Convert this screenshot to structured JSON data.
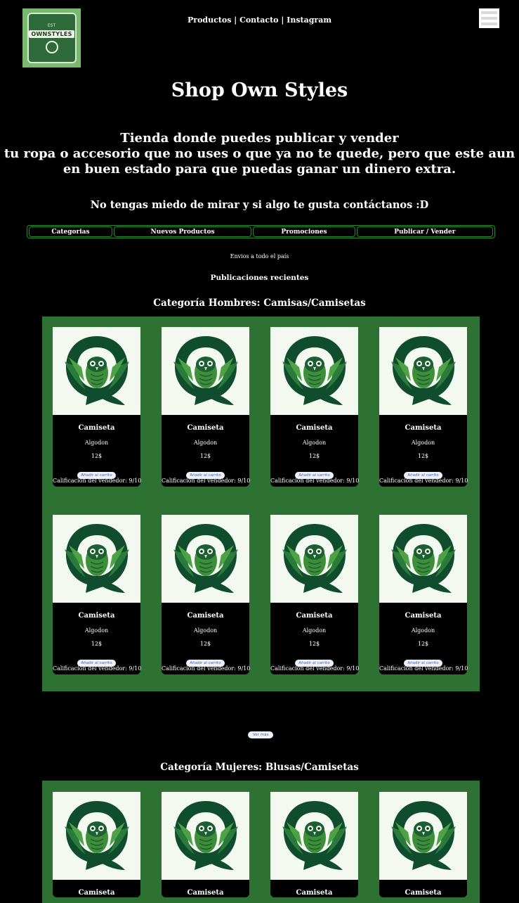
{
  "brand": {
    "logo_top": "EST",
    "logo_text": "OWNSTYLES"
  },
  "nav": {
    "items": [
      "Productos",
      "Contacto",
      "Instagram"
    ],
    "separator": " | "
  },
  "title": "Shop Own Styles",
  "tagline": {
    "line1": "Tienda donde puedes publicar y vender",
    "line2": "tu ropa o accesorio que no uses o que ya no te quede, pero que este aun en buen estado para que puedas ganar un dinero extra."
  },
  "subtagline": "No tengas miedo de mirar y si algo te gusta contáctanos :D",
  "menu": [
    "Categorias",
    "Nuevos Productos",
    "Promociones",
    "Publicar / Vender"
  ],
  "shipping": "Envios a todo el país",
  "recent_label": "Publicaciones recientes",
  "categories": [
    {
      "title": "Categoría Hombres: Camisas/Camisetas",
      "products": [
        {
          "name": "Camiseta",
          "material": "Algodon",
          "price": "12$",
          "button": "Añadir al carrito",
          "rating": "Calificación del vendedor: 9/10"
        },
        {
          "name": "Camiseta",
          "material": "Algodon",
          "price": "12$",
          "button": "Añadir al carrito",
          "rating": "Calificación del vendedor: 9/10"
        },
        {
          "name": "Camiseta",
          "material": "Algodon",
          "price": "12$",
          "button": "Añadir al carrito",
          "rating": "Calificación del vendedor: 9/10"
        },
        {
          "name": "Camiseta",
          "material": "Algodon",
          "price": "12$",
          "button": "Añadir al carrito",
          "rating": "Calificación del vendedor: 9/10"
        },
        {
          "name": "Camiseta",
          "material": "Algodon",
          "price": "12$",
          "button": "Añadir al carrito",
          "rating": "Calificación del vendedor: 9/10"
        },
        {
          "name": "Camiseta",
          "material": "Algodon",
          "price": "12$",
          "button": "Añadir al carrito",
          "rating": "Calificación del vendedor: 9/10"
        },
        {
          "name": "Camiseta",
          "material": "Algodon",
          "price": "12$",
          "button": "Añadir al carrito",
          "rating": "Calificación del vendedor: 9/10"
        },
        {
          "name": "Camiseta",
          "material": "Algodon",
          "price": "12$",
          "button": "Añadir al carrito",
          "rating": "Calificación del vendedor: 9/10"
        }
      ],
      "more_button": "Ver más"
    },
    {
      "title": "Categoría Mujeres: Blusas/Camisetas",
      "products": [
        {
          "name": "Camiseta"
        },
        {
          "name": "Camiseta"
        },
        {
          "name": "Camiseta"
        },
        {
          "name": "Camiseta"
        }
      ]
    }
  ],
  "colors": {
    "background": "#000000",
    "panel": "#2d7233",
    "menu_border": "#1e8a2a",
    "owl_dark": "#0f4d2e",
    "owl_light": "#3f8f3a"
  },
  "icons": {
    "menu": "hamburger-icon",
    "product_image": "owl-q-logo"
  }
}
